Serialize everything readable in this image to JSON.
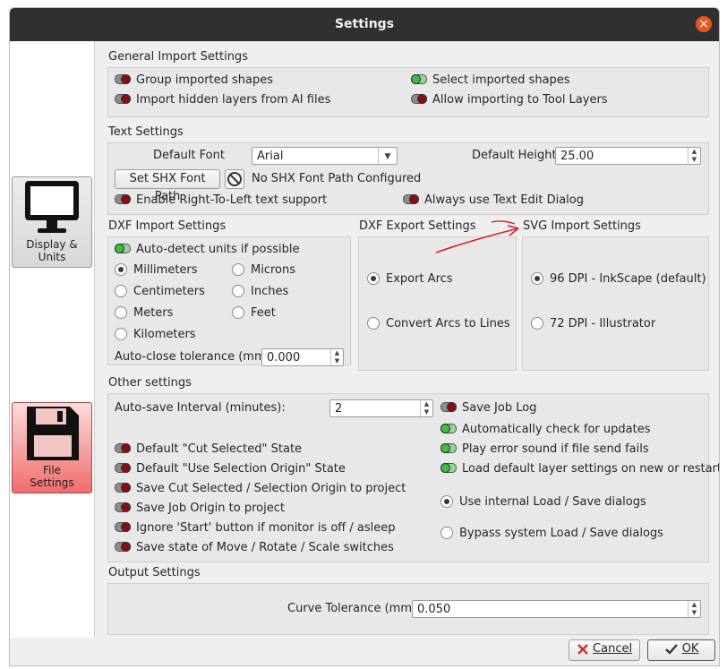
{
  "window": {
    "title": "Settings"
  },
  "sidebar": {
    "items": [
      {
        "label": "Display &\nUnits",
        "icon": "monitor-icon",
        "active": false
      },
      {
        "label": "File\nSettings",
        "icon": "floppy-disk-icon",
        "active": true
      }
    ]
  },
  "general": {
    "title": "General Import Settings",
    "group_shapes": "Group imported shapes",
    "select_shapes": "Select imported shapes",
    "import_hidden": "Import hidden layers from AI files",
    "tool_layers": "Allow importing to Tool Layers"
  },
  "text": {
    "title": "Text Settings",
    "default_font_label": "Default Font",
    "default_font_value": "Arial",
    "default_height_label": "Default Height",
    "default_height_value": "25.00",
    "shx_button": "Set SHX Font Path",
    "shx_status": "No SHX Font Path Configured",
    "rtl": "Enable Right-To-Left text support",
    "always_edit": "Always use Text Edit Dialog"
  },
  "dxf_import": {
    "title": "DXF Import Settings",
    "auto_detect": "Auto-detect units if possible",
    "millimeters": "Millimeters",
    "microns": "Microns",
    "centimeters": "Centimeters",
    "inches": "Inches",
    "meters": "Meters",
    "feet": "Feet",
    "kilometers": "Kilometers",
    "tolerance_label": "Auto-close tolerance (mm)",
    "tolerance_value": "0.000"
  },
  "dxf_export": {
    "title": "DXF Export Settings",
    "export_arcs": "Export Arcs",
    "convert_arcs": "Convert Arcs to Lines"
  },
  "svg_import": {
    "title": "SVG Import Settings",
    "dpi96": "96 DPI - InkScape (default)",
    "dpi72": "72 DPI - Illustrator"
  },
  "other": {
    "title": "Other settings",
    "autosave_label": "Auto-save Interval (minutes):",
    "autosave_value": "2",
    "save_job_log": "Save Job Log",
    "auto_check": "Automatically check for updates",
    "play_error": "Play error sound if file send fails",
    "load_default": "Load default layer settings on new or restart",
    "cut_selected": "Default \"Cut Selected\" State",
    "use_origin": "Default \"Use Selection Origin\" State",
    "save_cut": "Save Cut Selected / Selection Origin to project",
    "save_origin": "Save Job Origin to project",
    "ignore_start": "Ignore 'Start' button if monitor is off / asleep",
    "save_state": "Save state of Move / Rotate / Scale switches",
    "internal_dialogs": "Use internal Load / Save dialogs",
    "bypass_dialogs": "Bypass system Load / Save dialogs"
  },
  "output": {
    "title": "Output Settings",
    "curve_label": "Curve Tolerance (mm)",
    "curve_value": "0.050"
  },
  "footer": {
    "cancel": "Cancel",
    "ok": "OK"
  },
  "colors": {
    "titlebar": "#303030",
    "close": "#e95420",
    "toggle_on": "#3cbf3c",
    "toggle_off": "#8b0e0e",
    "annotation": "#e02020"
  }
}
